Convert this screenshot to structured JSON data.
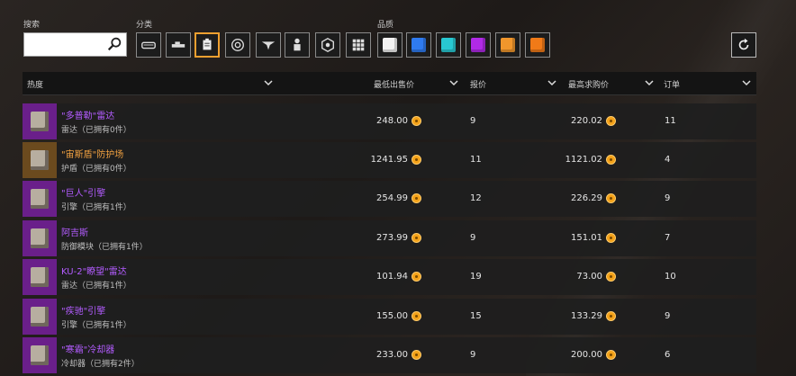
{
  "labels": {
    "search": "搜索",
    "category": "分类",
    "rarity": "品质"
  },
  "search": {
    "value": "",
    "placeholder": ""
  },
  "rarity_colors": [
    "#f2f2f2",
    "#2f7bf0",
    "#28c8d2",
    "#b02ae6",
    "#f0962c",
    "#f07a18"
  ],
  "header": {
    "col1": "热度",
    "col2": "最低出售价",
    "col3": "报价",
    "col4": "最高求购价",
    "col5": "订单"
  },
  "rows": [
    {
      "name": "\"多普勒\"雷达",
      "sub": "雷达（已拥有0件）",
      "min_sell": "248.00",
      "quotes": "9",
      "max_buy": "220.02",
      "orders": "11",
      "rarity": "purple"
    },
    {
      "name": "\"宙斯盾\"防护场",
      "sub": "护盾（已拥有0件）",
      "min_sell": "1241.95",
      "quotes": "11",
      "max_buy": "1121.02",
      "orders": "4",
      "rarity": "orange"
    },
    {
      "name": "\"巨人\"引擎",
      "sub": "引擎（已拥有1件）",
      "min_sell": "254.99",
      "quotes": "12",
      "max_buy": "226.29",
      "orders": "9",
      "rarity": "purple"
    },
    {
      "name": "阿吉斯",
      "sub": "防御模块（已拥有1件）",
      "min_sell": "273.99",
      "quotes": "9",
      "max_buy": "151.01",
      "orders": "7",
      "rarity": "purple"
    },
    {
      "name": "KU-2\"瞭望\"雷达",
      "sub": "雷达（已拥有1件）",
      "min_sell": "101.94",
      "quotes": "19",
      "max_buy": "73.00",
      "orders": "10",
      "rarity": "purple"
    },
    {
      "name": "\"疾驰\"引擎",
      "sub": "引擎（已拥有1件）",
      "min_sell": "155.00",
      "quotes": "15",
      "max_buy": "133.29",
      "orders": "9",
      "rarity": "purple"
    },
    {
      "name": "\"寒霜\"冷却器",
      "sub": "冷却器（已拥有2件）",
      "min_sell": "233.00",
      "quotes": "9",
      "max_buy": "200.00",
      "orders": "6",
      "rarity": "purple"
    }
  ]
}
